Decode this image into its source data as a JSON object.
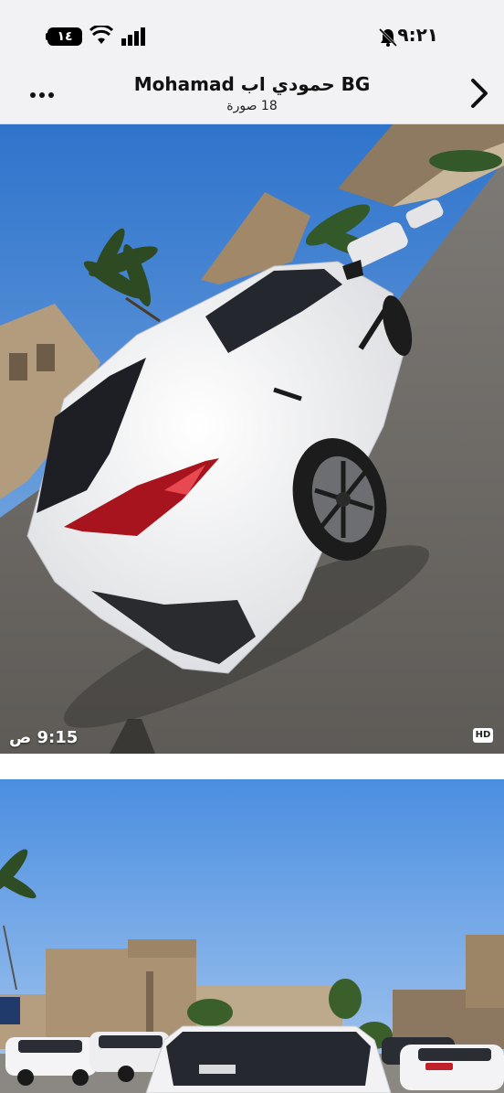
{
  "status_bar": {
    "battery": "١٤",
    "time": "٩:٢١",
    "icons": [
      "battery-icon",
      "wifi-icon",
      "signal-icon",
      "mute-bell-icon"
    ]
  },
  "header": {
    "title": "Mohamad حمودي اب BG",
    "subtitle": "18 صورة",
    "icons": [
      "more-dots-icon",
      "chevron-right-icon"
    ]
  },
  "photos": [
    {
      "timestamp": "9:15 ص",
      "badge": "HD",
      "subject": "white-suv-rear-angle"
    },
    {
      "subject": "white-suv-rear-street"
    }
  ],
  "colors": {
    "bar_bg": "#f2f2f4",
    "sky": "#3f84d6",
    "road": "#8a8680",
    "car": "#f4f4f4"
  }
}
